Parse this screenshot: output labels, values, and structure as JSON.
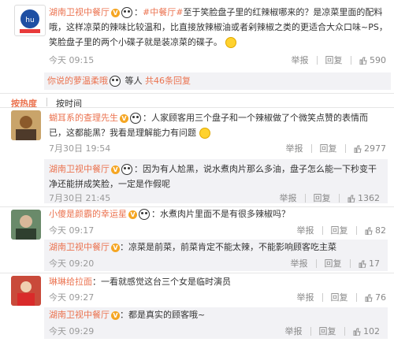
{
  "header_comment": {
    "user": "湖南卫视中餐厅",
    "text_prefix": "：",
    "hashtag": "#中餐厅#",
    "text": "至于笑脸盘子里的红辣椒哪来的？是凉菜里面的配料哦，这样凉菜的辣味比较温和，比直接放辣椒油或者剁辣椒之类的更适合大众口味~PS，笑脸盘子里的两个小碟子就是装凉菜的碟子。",
    "time": "今天 09:15",
    "actions": {
      "report": "举报",
      "reply": "回复",
      "likes": "590"
    },
    "reply_summary": "你说的萝温柔哦",
    "reply_summary_suffix": " 等人",
    "reply_count": "共46条回复"
  },
  "sort_bar": {
    "hot": "按热度",
    "time": "按时间"
  },
  "comments": [
    {
      "user": "蝴耳系的查理先生",
      "text": "：人家顾客用三个盘子和一个辣椒做了个微笑点赞的表情而已，这都能黑？我看是理解能力有问题",
      "time": "7月30日 19:54",
      "actions": {
        "report": "举报",
        "reply": "回复",
        "likes": "2977"
      },
      "reply": {
        "user": "湖南卫视中餐厅",
        "text": "：因为有人尬黑，说水煮肉片那么多油，盘子怎么能一下秒变干净还能拼成笑脸，一定是作假呢",
        "time": "7月30日 21:45",
        "actions": {
          "report": "举报",
          "reply": "回复",
          "likes": "1362"
        }
      }
    },
    {
      "user": "小傻是颜霸的幸运星",
      "text": "：水煮肉片里面不是有很多辣椒吗？",
      "time": "今天 09:17",
      "actions": {
        "report": "举报",
        "reply": "回复",
        "likes": "82"
      },
      "reply": {
        "user": "湖南卫视中餐厅",
        "text": "：凉菜是前菜，前菜肯定不能太辣，不能影响顾客吃主菜",
        "time": "今天 09:20",
        "actions": {
          "report": "举报",
          "reply": "回复",
          "likes": "17"
        }
      }
    },
    {
      "user": "琳琳给拉面",
      "text": "：一看就感觉这台三个女是临时演员",
      "time": "今天 09:27",
      "actions": {
        "report": "举报",
        "reply": "回复",
        "likes": "76"
      },
      "reply": {
        "user": "湖南卫视中餐厅",
        "text": "：都是真实的顾客哦~",
        "time": "今天 09:29",
        "actions": {
          "report": "举报",
          "reply": "回复",
          "likes": "102"
        }
      }
    }
  ],
  "colors": {
    "link": "#eb7350",
    "reply_bg": "#f2f2f5",
    "badge": "#f5a623"
  }
}
